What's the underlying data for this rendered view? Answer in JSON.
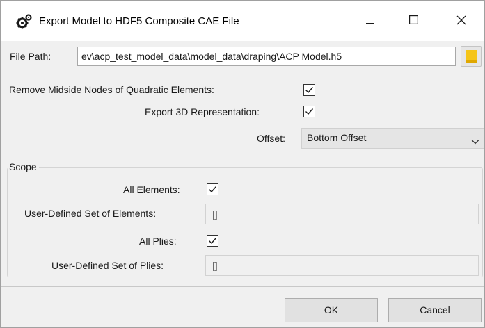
{
  "window": {
    "title": "Export Model to HDF5 Composite CAE File",
    "app_icon": "gears-icon"
  },
  "file_path": {
    "label": "File Path:",
    "value": "ev\\acp_test_model_data\\model_data\\draping\\ACP Model.h5",
    "browse_icon": "folder-icon"
  },
  "options": {
    "remove_midside_label": "Remove Midside Nodes of Quadratic Elements:",
    "remove_midside_checked": true,
    "export_3d_label": "Export 3D Representation:",
    "export_3d_checked": true,
    "offset_label": "Offset:",
    "offset_value": "Bottom Offset"
  },
  "scope": {
    "title": "Scope",
    "all_elements_label": "All Elements:",
    "all_elements_checked": true,
    "user_elements_label": "User-Defined Set of Elements:",
    "user_elements_value": "[]",
    "all_plies_label": "All Plies:",
    "all_plies_checked": true,
    "user_plies_label": "User-Defined Set of Plies:",
    "user_plies_value": "[]"
  },
  "buttons": {
    "ok": "OK",
    "cancel": "Cancel"
  },
  "colors": {
    "window_bg": "#f0f0f0",
    "titlebar_bg": "#ffffff",
    "folder_accent": "#f5c518"
  }
}
